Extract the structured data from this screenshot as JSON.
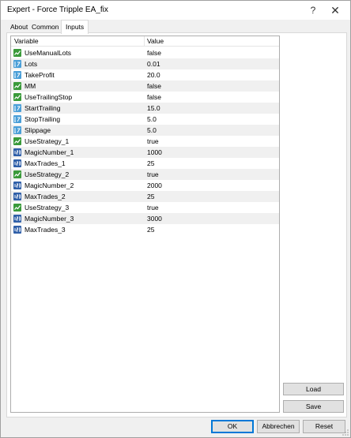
{
  "window": {
    "title": "Expert - Force Tripple EA_fix",
    "help_glyph": "?",
    "close_glyph": "✕"
  },
  "tabs": [
    {
      "label": "About"
    },
    {
      "label": "Common"
    },
    {
      "label": "Inputs"
    }
  ],
  "table": {
    "headers": {
      "variable": "Variable",
      "value": "Value"
    },
    "rows": [
      {
        "name": "UseManualLots",
        "value": "false",
        "icon": "boolean-icon"
      },
      {
        "name": "Lots",
        "value": "0.01",
        "icon": "double-icon"
      },
      {
        "name": "TakeProfit",
        "value": "20.0",
        "icon": "double-icon"
      },
      {
        "name": "MM",
        "value": "false",
        "icon": "boolean-icon"
      },
      {
        "name": "UseTrailingStop",
        "value": "false",
        "icon": "boolean-icon"
      },
      {
        "name": "StartTrailing",
        "value": "15.0",
        "icon": "double-icon"
      },
      {
        "name": "StopTrailing",
        "value": "5.0",
        "icon": "double-icon"
      },
      {
        "name": "Slippage",
        "value": "5.0",
        "icon": "double-icon"
      },
      {
        "name": "UseStrategy_1",
        "value": "true",
        "icon": "boolean-icon"
      },
      {
        "name": "MagicNumber_1",
        "value": "1000",
        "icon": "integer-icon"
      },
      {
        "name": "MaxTrades_1",
        "value": "25",
        "icon": "integer-icon"
      },
      {
        "name": "UseStrategy_2",
        "value": "true",
        "icon": "boolean-icon"
      },
      {
        "name": "MagicNumber_2",
        "value": "2000",
        "icon": "integer-icon"
      },
      {
        "name": "MaxTrades_2",
        "value": "25",
        "icon": "integer-icon"
      },
      {
        "name": "UseStrategy_3",
        "value": "true",
        "icon": "boolean-icon"
      },
      {
        "name": "MagicNumber_3",
        "value": "3000",
        "icon": "integer-icon"
      },
      {
        "name": "MaxTrades_3",
        "value": "25",
        "icon": "integer-icon"
      }
    ]
  },
  "buttons": {
    "load": "Load",
    "save": "Save",
    "ok": "OK",
    "cancel": "Abbrechen",
    "reset": "Reset"
  },
  "colors": {
    "boolean_icon": "#3a9a3a",
    "double_icon": "#4a9fd8",
    "integer_icon": "#2f5fa8",
    "ok_border": "#0078d7"
  }
}
